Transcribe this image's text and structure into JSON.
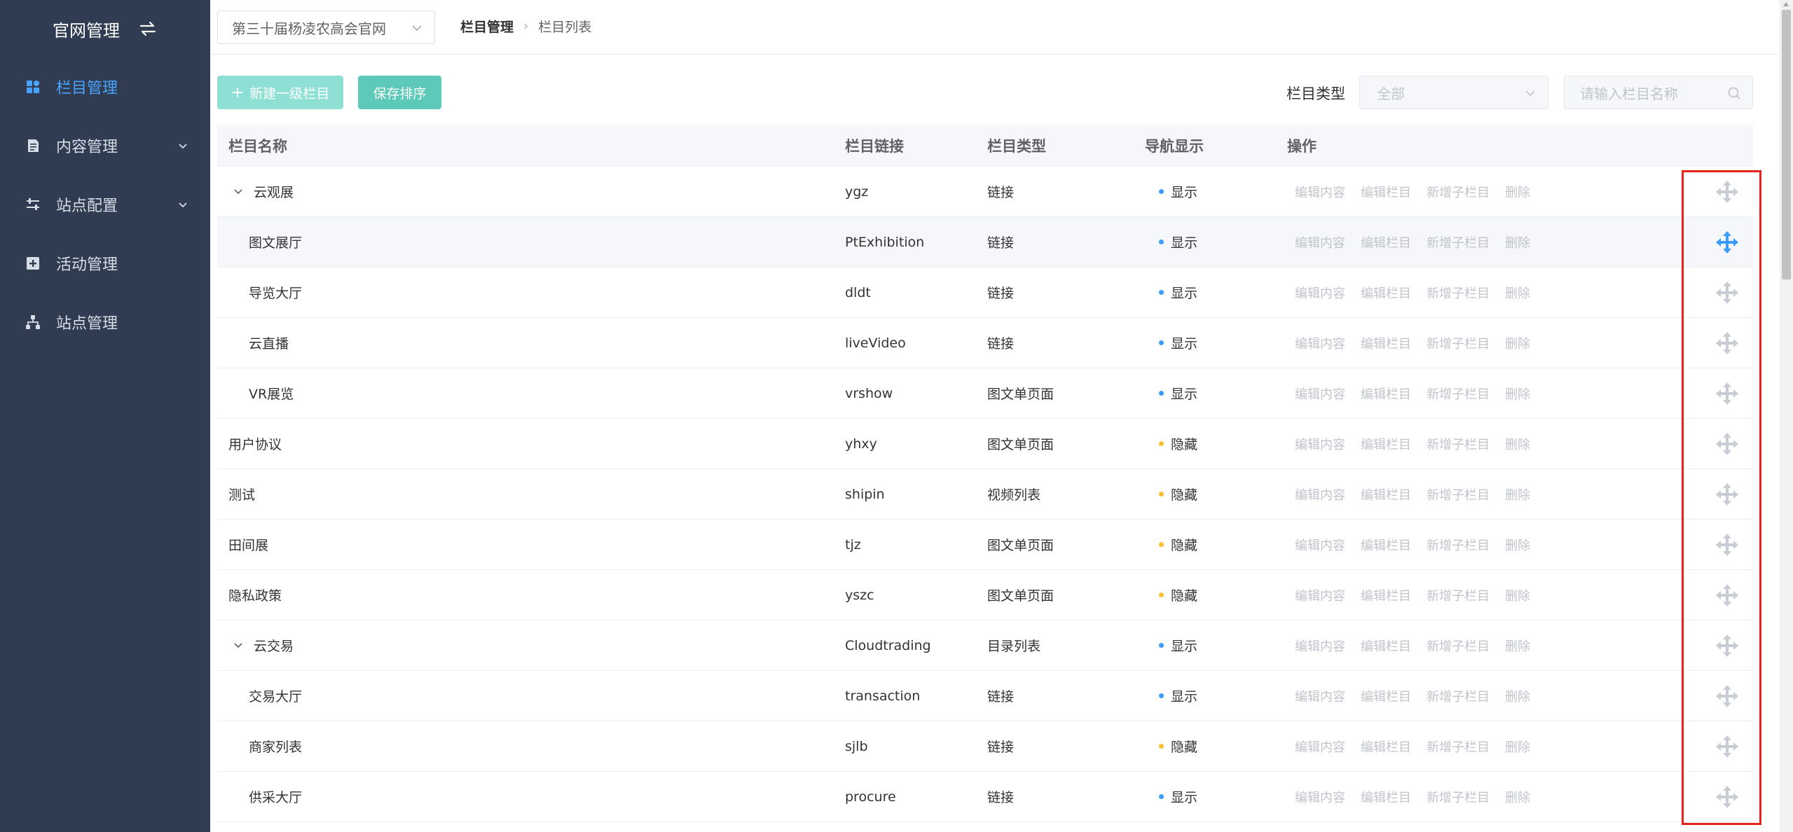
{
  "sidebar": {
    "title": "官网管理",
    "items": [
      {
        "label": "栏目管理",
        "icon": "dashboard-icon",
        "active": true
      },
      {
        "label": "内容管理",
        "icon": "document-icon",
        "has_arrow": true
      },
      {
        "label": "站点配置",
        "icon": "sliders-icon",
        "has_arrow": true
      },
      {
        "label": "活动管理",
        "icon": "plus-square-icon"
      },
      {
        "label": "站点管理",
        "icon": "org-chart-icon"
      }
    ]
  },
  "header": {
    "site_select": "第三十届杨凌农高会官网",
    "breadcrumb": [
      "栏目管理",
      "栏目列表"
    ]
  },
  "toolbar": {
    "new_button": "新建一级栏目",
    "save_button": "保存排序",
    "filter_label": "栏目类型",
    "type_select": "全部",
    "search_placeholder": "请输入栏目名称"
  },
  "table": {
    "columns": [
      "栏目名称",
      "栏目链接",
      "栏目类型",
      "导航显示",
      "操作"
    ],
    "ops": [
      "编辑内容",
      "编辑栏目",
      "新增子栏目",
      "删除"
    ],
    "rows": [
      {
        "name": "云观展",
        "link": "ygz",
        "type": "链接",
        "nav": "显示",
        "level": 0,
        "expanded": true
      },
      {
        "name": "图文展厅",
        "link": "PtExhibition",
        "type": "链接",
        "nav": "显示",
        "level": 1
      },
      {
        "name": "导览大厅",
        "link": "dldt",
        "type": "链接",
        "nav": "显示",
        "level": 1
      },
      {
        "name": "云直播",
        "link": "liveVideo",
        "type": "链接",
        "nav": "显示",
        "level": 1
      },
      {
        "name": "VR展览",
        "link": "vrshow",
        "type": "图文单页面",
        "nav": "显示",
        "level": 1
      },
      {
        "name": "用户协议",
        "link": "yhxy",
        "type": "图文单页面",
        "nav": "隐藏",
        "level": 0
      },
      {
        "name": "测试",
        "link": "shipin",
        "type": "视频列表",
        "nav": "隐藏",
        "level": 0
      },
      {
        "name": "田间展",
        "link": "tjz",
        "type": "图文单页面",
        "nav": "隐藏",
        "level": 0
      },
      {
        "name": "隐私政策",
        "link": "yszc",
        "type": "图文单页面",
        "nav": "隐藏",
        "level": 0
      },
      {
        "name": "云交易",
        "link": "Cloudtrading",
        "type": "目录列表",
        "nav": "显示",
        "level": 0,
        "expanded": true
      },
      {
        "name": "交易大厅",
        "link": "transaction",
        "type": "链接",
        "nav": "显示",
        "level": 1
      },
      {
        "name": "商家列表",
        "link": "sjlb",
        "type": "链接",
        "nav": "隐藏",
        "level": 1
      },
      {
        "name": "供采大厅",
        "link": "procure",
        "type": "链接",
        "nav": "显示",
        "level": 1
      }
    ]
  },
  "colors": {
    "sidebar_bg": "#2f3c51",
    "accent_blue": "#3c9bff",
    "teal_button": "#5cc9b9",
    "highlight_red": "#e5231a",
    "hidden_dot": "#f8c132"
  }
}
